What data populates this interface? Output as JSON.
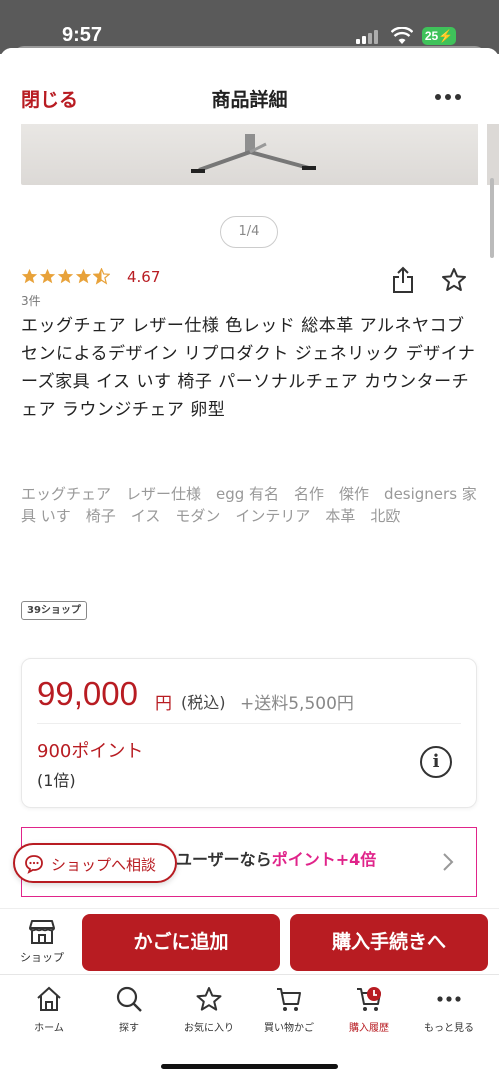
{
  "status_bar": {
    "time": "9:57",
    "battery": "25"
  },
  "header": {
    "close_label": "閉じる",
    "title": "商品詳細"
  },
  "gallery": {
    "pager": "1/4"
  },
  "rating": {
    "stars": 4.5,
    "value": "4.67",
    "reviews": "3件"
  },
  "product": {
    "title": "エッグチェア レザー仕様 色レッド 総本革 アルネヤコブセンによるデザイン リプロダクト ジェネリック デザイナーズ家具 イス いす 椅子 パーソナルチェア カウンターチェア ラウンジチェア 卵型",
    "tags": "エッグチェア　レザー仕様　egg 有名　名作　傑作　designers 家具 いす　椅子　イス　モダン　インテリア　本革　北欧",
    "shop_badge": "39ショップ"
  },
  "price": {
    "amount": "99,000",
    "unit": "円",
    "tax": "(税込)",
    "shipping": "+送料5,500円",
    "points": "900ポイント",
    "multiplier": "(1倍)"
  },
  "promo": {
    "text_prefix": "ユーザーなら",
    "highlight": "ポイント+4倍"
  },
  "consult": {
    "label": "ショップへ相談"
  },
  "actions": {
    "shop_label": "ショップ",
    "add_to_cart": "かごに追加",
    "checkout": "購入手続きへ"
  },
  "tabs": [
    {
      "label": "ホーム",
      "icon": "home-icon"
    },
    {
      "label": "探す",
      "icon": "search-icon"
    },
    {
      "label": "お気に入り",
      "icon": "star-icon"
    },
    {
      "label": "買い物かご",
      "icon": "cart-icon"
    },
    {
      "label": "購入履歴",
      "icon": "history-icon"
    },
    {
      "label": "もっと見る",
      "icon": "more-icon"
    }
  ],
  "colors": {
    "brand": "#b81c22",
    "star": "#e8a23a",
    "promo": "#e0248a"
  }
}
